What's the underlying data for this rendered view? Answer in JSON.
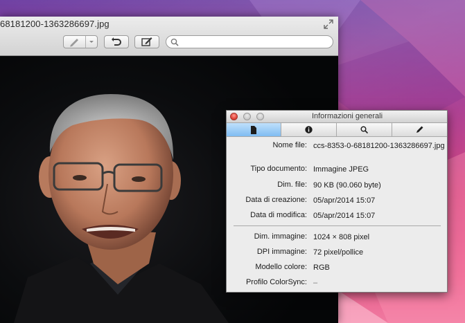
{
  "preview": {
    "title": "68181200-1363286697.jpg"
  },
  "inspector": {
    "title": "Informazioni generali",
    "tabs": [
      "general-info",
      "more-info",
      "keywords",
      "annotations"
    ],
    "rows": [
      {
        "label": "Nome file:",
        "value": "ccs-8353-0-68181200-1363286697.jpg"
      },
      {
        "label": "Tipo documento:",
        "value": "Immagine JPEG"
      },
      {
        "label": "Dim. file:",
        "value": "90 KB (90.060 byte)"
      },
      {
        "label": "Data di creazione:",
        "value": "05/apr/2014 15:07"
      },
      {
        "label": "Data di modifica:",
        "value": "05/apr/2014 15:07"
      },
      {
        "label": "Dim. immagine:",
        "value": "1024 × 808 pixel"
      },
      {
        "label": "DPI immagine:",
        "value": "72 pixel/pollice"
      },
      {
        "label": "Modello colore:",
        "value": "RGB"
      },
      {
        "label": "Profilo ColorSync:",
        "value": "–"
      }
    ]
  }
}
